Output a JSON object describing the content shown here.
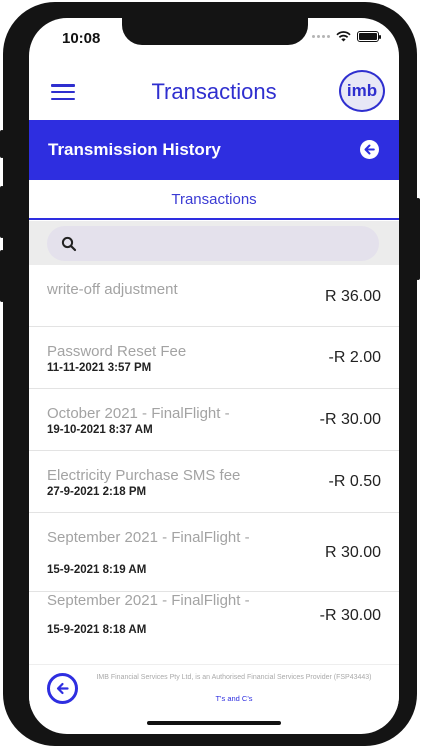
{
  "status": {
    "time": "10:08"
  },
  "header": {
    "title": "Transactions",
    "logo_text": "imb",
    "menu_icon": "hamburger-menu-icon",
    "accent_color": "#2e2ee0"
  },
  "section": {
    "title": "Transmission History",
    "back_icon": "back-arrow-icon"
  },
  "tabs": {
    "active": "Transactions"
  },
  "search": {
    "icon": "search-icon",
    "placeholder": ""
  },
  "transactions": [
    {
      "description": "write-off adjustment",
      "date": "",
      "amount": "R 36.00"
    },
    {
      "description": "Password Reset Fee",
      "date": "11-11-2021  3:57 PM",
      "amount": "-R 2.00"
    },
    {
      "description": "October 2021 - FinalFlight -",
      "date": "19-10-2021  8:37 AM",
      "amount": "-R 30.00"
    },
    {
      "description": "Electricity Purchase SMS fee",
      "date": "27-9-2021  2:18 PM",
      "amount": "-R 0.50"
    },
    {
      "description": "September 2021 - FinalFlight -",
      "date": "15-9-2021  8:19 AM",
      "amount": "R 30.00"
    },
    {
      "description": "September 2021 - FinalFlight -",
      "date": "15-9-2021  8:18 AM",
      "amount": "-R 30.00"
    }
  ],
  "footer": {
    "disclaimer": "IMB Financial Services Pty Ltd, is an Authorised Financial Services Provider (FSP43443)",
    "terms_link": "T's and C's",
    "back_icon": "back-arrow-icon"
  }
}
